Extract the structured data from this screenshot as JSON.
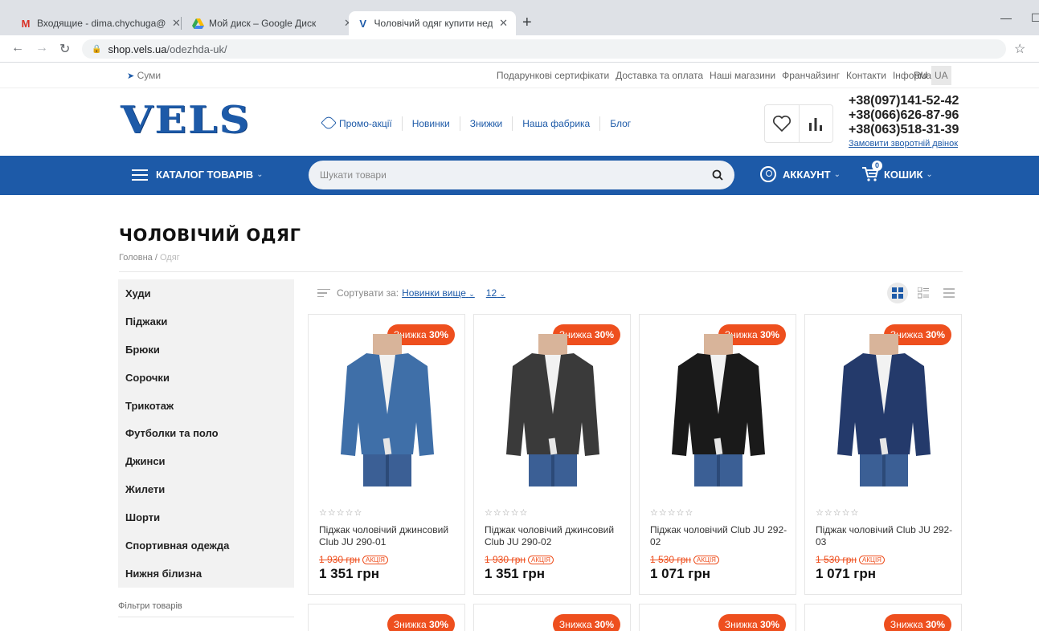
{
  "browser": {
    "tabs": [
      {
        "title": "Входящие - dima.chychuga@gm"
      },
      {
        "title": "Мой диск – Google Диск"
      },
      {
        "title": "Чоловічий одяг купити недорог"
      }
    ],
    "url_host": "shop.vels.ua",
    "url_path": "/odezhda-uk/"
  },
  "topbar": {
    "city": "Суми",
    "links": [
      "Подарункові сертифікати",
      "Доставка та оплата",
      "Наші магазини",
      "Франчайзинг",
      "Контакти",
      "Інформація"
    ],
    "lang_ru": "RU",
    "lang_ua": "UA"
  },
  "header": {
    "logo": "VELS",
    "nav": [
      "Промо-акції",
      "Новинки",
      "Знижки",
      "Наша фабрика",
      "Блог"
    ],
    "phones": [
      "+38(097)141-52-42",
      "+38(066)626-87-96",
      "+38(063)518-31-39"
    ],
    "callback": "Замовити зворотній двінок"
  },
  "bluebar": {
    "catalog": "КАТАЛОГ ТОВАРІВ",
    "search_placeholder": "Шукати товари",
    "account": "АККАУНТ",
    "cart": "КОШИК",
    "cart_count": "0"
  },
  "page": {
    "title": "ЧОЛОВІЧИЙ ОДЯГ",
    "breadcrumb_home": "Головна",
    "breadcrumb_current": "Одяг"
  },
  "sidebar": {
    "categories": [
      "Худи",
      "Піджаки",
      "Брюки",
      "Сорочки",
      "Трикотаж",
      "Футболки та поло",
      "Джинси",
      "Жилети",
      "Шорти",
      "Спортивная одежда",
      "Нижня білизна"
    ],
    "filters": "Фільтри товарів"
  },
  "sort": {
    "label": "Сортувати за:",
    "value": "Новинки вище",
    "per_page": "12"
  },
  "products": [
    {
      "badge_label": "Знижка",
      "badge_pct": "30%",
      "stars": "☆☆☆☆☆",
      "name": "Піджак чоловічий джинсовий Club JU 290-01",
      "old_price": "1 930 грн",
      "akcia": "АКЦІЯ",
      "price": "1 351 грн",
      "jacket": "#3f6fa8"
    },
    {
      "badge_label": "Знижка",
      "badge_pct": "30%",
      "stars": "☆☆☆☆☆",
      "name": "Піджак чоловічий джинсовий Club JU 290-02",
      "old_price": "1 930 грн",
      "akcia": "АКЦІЯ",
      "price": "1 351 грн",
      "jacket": "#3a3a3a"
    },
    {
      "badge_label": "Знижка",
      "badge_pct": "30%",
      "stars": "☆☆☆☆☆",
      "name": "Піджак чоловічий Club JU 292-02",
      "old_price": "1 530 грн",
      "akcia": "АКЦІЯ",
      "price": "1 071 грн",
      "jacket": "#1a1a1a"
    },
    {
      "badge_label": "Знижка",
      "badge_pct": "30%",
      "stars": "☆☆☆☆☆",
      "name": "Піджак чоловічий Club JU 292-03",
      "old_price": "1 530 грн",
      "akcia": "АКЦІЯ",
      "price": "1 071 грн",
      "jacket": "#243a6b"
    }
  ],
  "row2_badges": [
    {
      "label": "Знижка",
      "pct": "30%"
    },
    {
      "label": "Знижка",
      "pct": "30%"
    },
    {
      "label": "Знижка",
      "pct": "30%"
    },
    {
      "label": "Знижка",
      "pct": "30%"
    }
  ],
  "colors": {
    "brand": "#1d5aa8",
    "accent": "#ee4f1e"
  }
}
